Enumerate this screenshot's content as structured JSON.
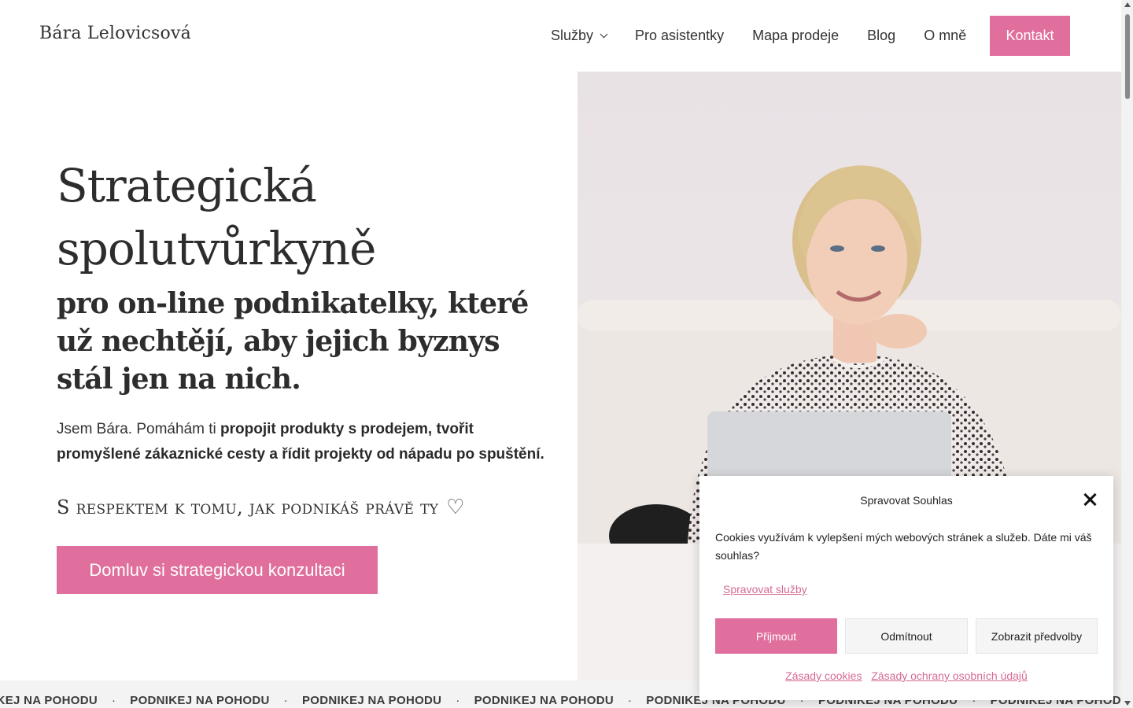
{
  "header": {
    "logo": "Bára Lelovicsová",
    "nav": [
      {
        "label": "Služby"
      },
      {
        "label": "Pro asistentky"
      },
      {
        "label": "Mapa prodeje"
      },
      {
        "label": "Blog"
      },
      {
        "label": "O mně"
      }
    ],
    "contact_label": "Kontakt"
  },
  "hero": {
    "title_line1": "Strategická",
    "title_line2": "spolutvůrkyně",
    "subtitle": "pro on-line podnikatelky, které už nechtějí, aby jejich byznys stál jen na nich.",
    "intro_plain": "Jsem Bára. Pomáhám ti ",
    "intro_bold": "propojit produkty s prodejem, tvořit promyšlené zákaznické cesty a řídit projekty od nápadu po spuštění.",
    "tagline": "S respektem k tomu, jak podnikáš právě ty",
    "heart": "♡",
    "cta_label": "Domluv si strategickou konzultaci"
  },
  "marquee": {
    "item": "PODNIKEJ NA POHODU",
    "first_item": "NIKEJ NA POHODU",
    "separator": "·"
  },
  "cookie": {
    "title": "Spravovat Souhlas",
    "text": "Cookies využívám k vylepšení mých webových stránek a služeb. Dáte mi váš souhlas?",
    "manage_label": "Spravovat služby",
    "accept_label": "Přijmout",
    "deny_label": "Odmítnout",
    "prefs_label": "Zobrazit předvolby",
    "link_cookies": "Zásady cookies",
    "link_privacy": "Zásady ochrany osobních údajů"
  },
  "colors": {
    "accent": "#e06f9d",
    "link": "#d66a95",
    "text": "#2b2b2b"
  }
}
